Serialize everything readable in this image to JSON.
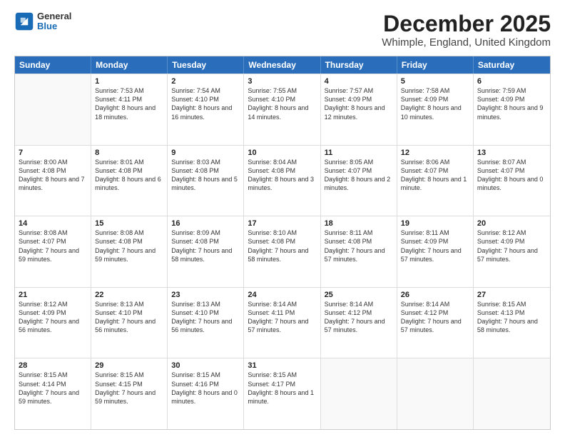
{
  "header": {
    "logo": {
      "line1": "General",
      "line2": "Blue"
    },
    "title": "December 2025",
    "subtitle": "Whimple, England, United Kingdom"
  },
  "calendar": {
    "weekdays": [
      "Sunday",
      "Monday",
      "Tuesday",
      "Wednesday",
      "Thursday",
      "Friday",
      "Saturday"
    ],
    "rows": [
      [
        {
          "day": "",
          "empty": true
        },
        {
          "day": "1",
          "rise": "Sunrise: 7:53 AM",
          "set": "Sunset: 4:11 PM",
          "daylight": "Daylight: 8 hours and 18 minutes."
        },
        {
          "day": "2",
          "rise": "Sunrise: 7:54 AM",
          "set": "Sunset: 4:10 PM",
          "daylight": "Daylight: 8 hours and 16 minutes."
        },
        {
          "day": "3",
          "rise": "Sunrise: 7:55 AM",
          "set": "Sunset: 4:10 PM",
          "daylight": "Daylight: 8 hours and 14 minutes."
        },
        {
          "day": "4",
          "rise": "Sunrise: 7:57 AM",
          "set": "Sunset: 4:09 PM",
          "daylight": "Daylight: 8 hours and 12 minutes."
        },
        {
          "day": "5",
          "rise": "Sunrise: 7:58 AM",
          "set": "Sunset: 4:09 PM",
          "daylight": "Daylight: 8 hours and 10 minutes."
        },
        {
          "day": "6",
          "rise": "Sunrise: 7:59 AM",
          "set": "Sunset: 4:09 PM",
          "daylight": "Daylight: 8 hours and 9 minutes."
        }
      ],
      [
        {
          "day": "7",
          "rise": "Sunrise: 8:00 AM",
          "set": "Sunset: 4:08 PM",
          "daylight": "Daylight: 8 hours and 7 minutes."
        },
        {
          "day": "8",
          "rise": "Sunrise: 8:01 AM",
          "set": "Sunset: 4:08 PM",
          "daylight": "Daylight: 8 hours and 6 minutes."
        },
        {
          "day": "9",
          "rise": "Sunrise: 8:03 AM",
          "set": "Sunset: 4:08 PM",
          "daylight": "Daylight: 8 hours and 5 minutes."
        },
        {
          "day": "10",
          "rise": "Sunrise: 8:04 AM",
          "set": "Sunset: 4:08 PM",
          "daylight": "Daylight: 8 hours and 3 minutes."
        },
        {
          "day": "11",
          "rise": "Sunrise: 8:05 AM",
          "set": "Sunset: 4:07 PM",
          "daylight": "Daylight: 8 hours and 2 minutes."
        },
        {
          "day": "12",
          "rise": "Sunrise: 8:06 AM",
          "set": "Sunset: 4:07 PM",
          "daylight": "Daylight: 8 hours and 1 minute."
        },
        {
          "day": "13",
          "rise": "Sunrise: 8:07 AM",
          "set": "Sunset: 4:07 PM",
          "daylight": "Daylight: 8 hours and 0 minutes."
        }
      ],
      [
        {
          "day": "14",
          "rise": "Sunrise: 8:08 AM",
          "set": "Sunset: 4:07 PM",
          "daylight": "Daylight: 7 hours and 59 minutes."
        },
        {
          "day": "15",
          "rise": "Sunrise: 8:08 AM",
          "set": "Sunset: 4:08 PM",
          "daylight": "Daylight: 7 hours and 59 minutes."
        },
        {
          "day": "16",
          "rise": "Sunrise: 8:09 AM",
          "set": "Sunset: 4:08 PM",
          "daylight": "Daylight: 7 hours and 58 minutes."
        },
        {
          "day": "17",
          "rise": "Sunrise: 8:10 AM",
          "set": "Sunset: 4:08 PM",
          "daylight": "Daylight: 7 hours and 58 minutes."
        },
        {
          "day": "18",
          "rise": "Sunrise: 8:11 AM",
          "set": "Sunset: 4:08 PM",
          "daylight": "Daylight: 7 hours and 57 minutes."
        },
        {
          "day": "19",
          "rise": "Sunrise: 8:11 AM",
          "set": "Sunset: 4:09 PM",
          "daylight": "Daylight: 7 hours and 57 minutes."
        },
        {
          "day": "20",
          "rise": "Sunrise: 8:12 AM",
          "set": "Sunset: 4:09 PM",
          "daylight": "Daylight: 7 hours and 57 minutes."
        }
      ],
      [
        {
          "day": "21",
          "rise": "Sunrise: 8:12 AM",
          "set": "Sunset: 4:09 PM",
          "daylight": "Daylight: 7 hours and 56 minutes."
        },
        {
          "day": "22",
          "rise": "Sunrise: 8:13 AM",
          "set": "Sunset: 4:10 PM",
          "daylight": "Daylight: 7 hours and 56 minutes."
        },
        {
          "day": "23",
          "rise": "Sunrise: 8:13 AM",
          "set": "Sunset: 4:10 PM",
          "daylight": "Daylight: 7 hours and 56 minutes."
        },
        {
          "day": "24",
          "rise": "Sunrise: 8:14 AM",
          "set": "Sunset: 4:11 PM",
          "daylight": "Daylight: 7 hours and 57 minutes."
        },
        {
          "day": "25",
          "rise": "Sunrise: 8:14 AM",
          "set": "Sunset: 4:12 PM",
          "daylight": "Daylight: 7 hours and 57 minutes."
        },
        {
          "day": "26",
          "rise": "Sunrise: 8:14 AM",
          "set": "Sunset: 4:12 PM",
          "daylight": "Daylight: 7 hours and 57 minutes."
        },
        {
          "day": "27",
          "rise": "Sunrise: 8:15 AM",
          "set": "Sunset: 4:13 PM",
          "daylight": "Daylight: 7 hours and 58 minutes."
        }
      ],
      [
        {
          "day": "28",
          "rise": "Sunrise: 8:15 AM",
          "set": "Sunset: 4:14 PM",
          "daylight": "Daylight: 7 hours and 59 minutes."
        },
        {
          "day": "29",
          "rise": "Sunrise: 8:15 AM",
          "set": "Sunset: 4:15 PM",
          "daylight": "Daylight: 7 hours and 59 minutes."
        },
        {
          "day": "30",
          "rise": "Sunrise: 8:15 AM",
          "set": "Sunset: 4:16 PM",
          "daylight": "Daylight: 8 hours and 0 minutes."
        },
        {
          "day": "31",
          "rise": "Sunrise: 8:15 AM",
          "set": "Sunset: 4:17 PM",
          "daylight": "Daylight: 8 hours and 1 minute."
        },
        {
          "day": "",
          "empty": true
        },
        {
          "day": "",
          "empty": true
        },
        {
          "day": "",
          "empty": true
        }
      ]
    ]
  }
}
